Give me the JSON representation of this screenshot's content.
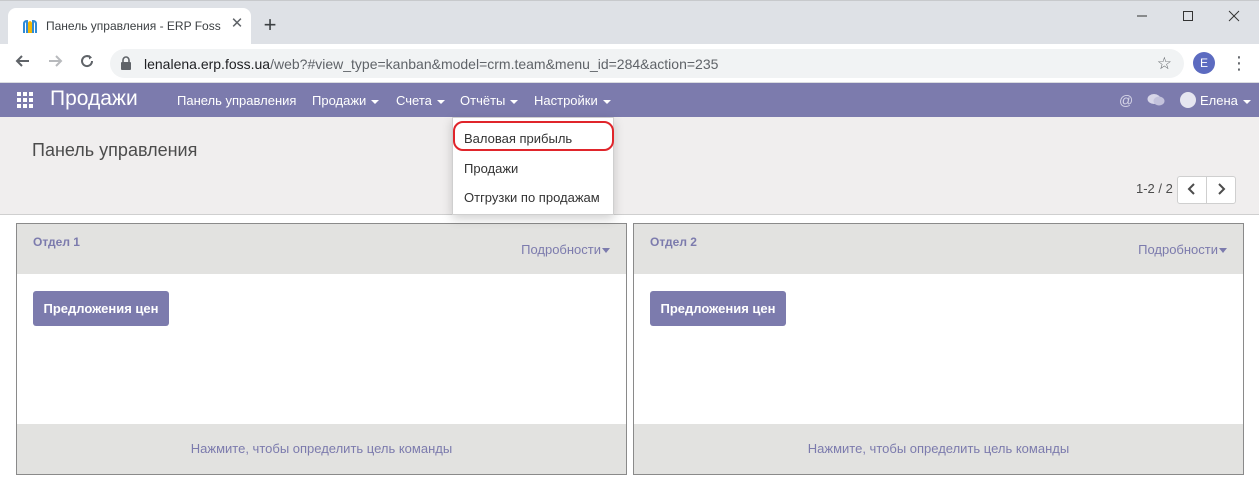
{
  "browser": {
    "tab_title": "Панель управления - ERP Foss",
    "new_tab_symbol": "+",
    "url_host": "lenalena.erp.foss.ua",
    "url_path": "/web?#view_type=kanban&model=crm.team&menu_id=284&action=235",
    "profile_initial": "E"
  },
  "navbar": {
    "brand": "Продажи",
    "menu": [
      {
        "label": "Панель управления",
        "has_caret": false
      },
      {
        "label": "Продажи",
        "has_caret": true
      },
      {
        "label": "Счета",
        "has_caret": true
      },
      {
        "label": "Отчёты",
        "has_caret": true
      },
      {
        "label": "Настройки",
        "has_caret": true
      }
    ],
    "user_name": "Елена",
    "colors": {
      "bar": "#7c7bad"
    }
  },
  "dropdown": {
    "items": [
      {
        "label": "Валовая прибыль",
        "highlighted": true
      },
      {
        "label": "Продажи"
      },
      {
        "label": "Отгрузки по продажам"
      }
    ],
    "highlight_color": "#e0252b"
  },
  "control_panel": {
    "title": "Панель управления",
    "pager": "1-2 / 2"
  },
  "teams": [
    {
      "name": "Отдел 1",
      "details_label": "Подробности",
      "button_label": "Предложения цен",
      "footer_label": "Нажмите, чтобы определить цель команды"
    },
    {
      "name": "Отдел 2",
      "details_label": "Подробности",
      "button_label": "Предложения цен",
      "footer_label": "Нажмите, чтобы определить цель команды"
    }
  ]
}
